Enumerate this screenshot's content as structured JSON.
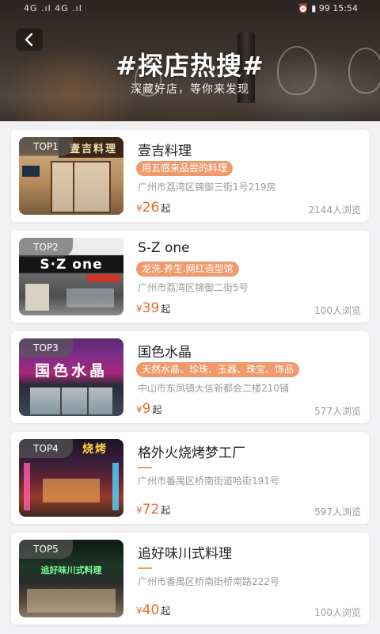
{
  "status_bar": {
    "left": "4G .ıl 4G .ıl",
    "right": "⏰ ▮ 99 15:54"
  },
  "header": {
    "back_icon": "chevron-left-icon",
    "title": "#探店热搜#",
    "subtitle": "深藏好店，等你来发现"
  },
  "shops": [
    {
      "rank": "TOP1",
      "name": "壹吉料理",
      "tag": "用五感来品尝的料理",
      "address": "广州市荔湾区锦御三街1号219房",
      "currency": "¥",
      "price": "26",
      "price_suffix": "起",
      "views": "2144人浏览",
      "sign_text": "壹吉料理"
    },
    {
      "rank": "TOP2",
      "name": "S-Z one",
      "tag": "龙洗.养生.网红造型馆",
      "address": "广州市荔湾区锦御二街5号",
      "currency": "¥",
      "price": "39",
      "price_suffix": "起",
      "views": "100人浏览",
      "sign_text": "S·Z one"
    },
    {
      "rank": "TOP3",
      "name": "国色水晶",
      "tag": "天然水晶、珍珠、玉器、珠宝、饰品",
      "address": "中山市东凤镇大信新都会二楼210铺",
      "currency": "¥",
      "price": "9",
      "price_suffix": "起",
      "views": "577人浏览",
      "sign_text": "国色水晶"
    },
    {
      "rank": "TOP4",
      "name": "格外火烧烤梦工厂",
      "tag": "",
      "address": "广州市番禺区桥南街道哈街191号",
      "currency": "¥",
      "price": "72",
      "price_suffix": "起",
      "views": "597人浏览",
      "sign_text": "烧烤"
    },
    {
      "rank": "TOP5",
      "name": "追好味川式料理",
      "tag": "",
      "address": "广州市番禺区桥南街桥南路222号",
      "currency": "¥",
      "price": "40",
      "price_suffix": "起",
      "views": "100人浏览",
      "sign_text": "追好味川式料理"
    }
  ],
  "colors": {
    "accent": "#f09a6b",
    "price": "#e26a2c",
    "muted": "#9a9a9a"
  }
}
